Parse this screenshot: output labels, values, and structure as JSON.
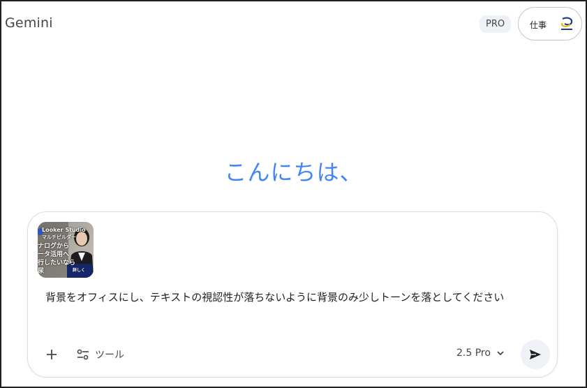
{
  "header": {
    "app_title": "Gemini",
    "plan_badge": "PRO",
    "account_label": "仕事",
    "account_logo_icon": "company-logo-icon"
  },
  "main": {
    "greeting": "こんにちは、"
  },
  "composer": {
    "attachment": {
      "lines": [
        "Looker Studio",
        "マルチビルダー",
        "ナログから",
        "ータ活用へ",
        "行したいなら",
        "尿"
      ],
      "button_text": "詳しく"
    },
    "prompt_text": "背景をオフィスにし、テキストの視認性が落ちないように背景のみ少しトーンを落としてください",
    "add_icon": "plus-icon",
    "tools_icon": "tune-icon",
    "tools_label": "ツール",
    "model_label": "2.5 Pro",
    "model_dropdown_icon": "chevron-down-icon",
    "send_icon": "send-icon"
  },
  "colors": {
    "greeting": "#4285f4",
    "text": "#1f1f1f",
    "muted": "#444746",
    "badge_bg": "#eef1f6"
  }
}
